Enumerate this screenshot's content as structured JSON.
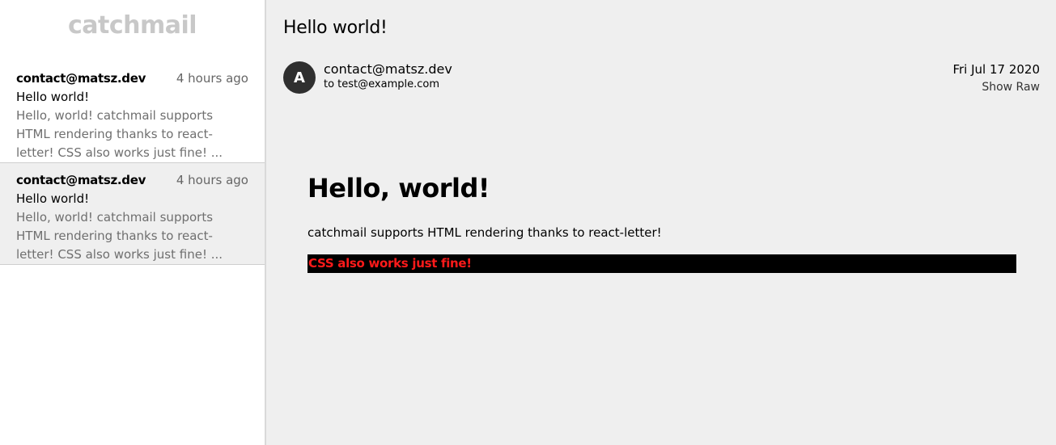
{
  "sidebar": {
    "brand": "catchmail",
    "items": [
      {
        "from": "contact@matsz.dev",
        "time": "4 hours ago",
        "subject": "Hello world!",
        "preview": "Hello, world! catchmail supports HTML rendering thanks to react-letter! CSS also works just fine! ...",
        "selected": false
      },
      {
        "from": "contact@matsz.dev",
        "time": "4 hours ago",
        "subject": "Hello world!",
        "preview": "Hello, world! catchmail supports HTML rendering thanks to react-letter! CSS also works just fine! ...",
        "selected": true
      }
    ]
  },
  "message": {
    "title": "Hello world!",
    "avatar_letter": "A",
    "from": "contact@matsz.dev",
    "to": "to test@example.com",
    "date": "Fri Jul 17 2020",
    "show_raw_label": "Show Raw",
    "body": {
      "heading": "Hello, world!",
      "paragraph": "catchmail supports HTML rendering thanks to react-letter!",
      "styled_text": "CSS also works just fine!"
    }
  },
  "colors": {
    "brand": "#c8c8c8",
    "selected_bg": "#efefef",
    "main_bg": "#efefef",
    "avatar_bg": "#2f2f2f",
    "styled_bg": "#000000",
    "styled_fg": "#ff1a1a"
  }
}
